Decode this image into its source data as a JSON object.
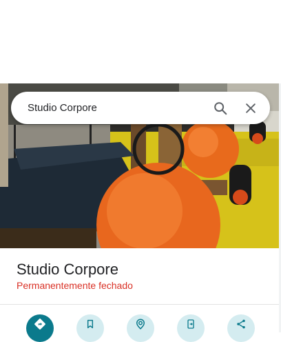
{
  "search": {
    "value": "Studio Corpore",
    "search_icon": "search-icon",
    "close_icon": "close-icon"
  },
  "place": {
    "name": "Studio Corpore",
    "status": "Permanentemente fechado",
    "status_color": "#d93025"
  },
  "actions": [
    {
      "icon": "directions-icon"
    },
    {
      "icon": "bookmark-icon"
    },
    {
      "icon": "nearby-icon"
    },
    {
      "icon": "send-to-phone-icon"
    },
    {
      "icon": "share-icon"
    }
  ],
  "colors": {
    "accent": "#0b7a8c",
    "action_bg": "#d4ecf0"
  }
}
